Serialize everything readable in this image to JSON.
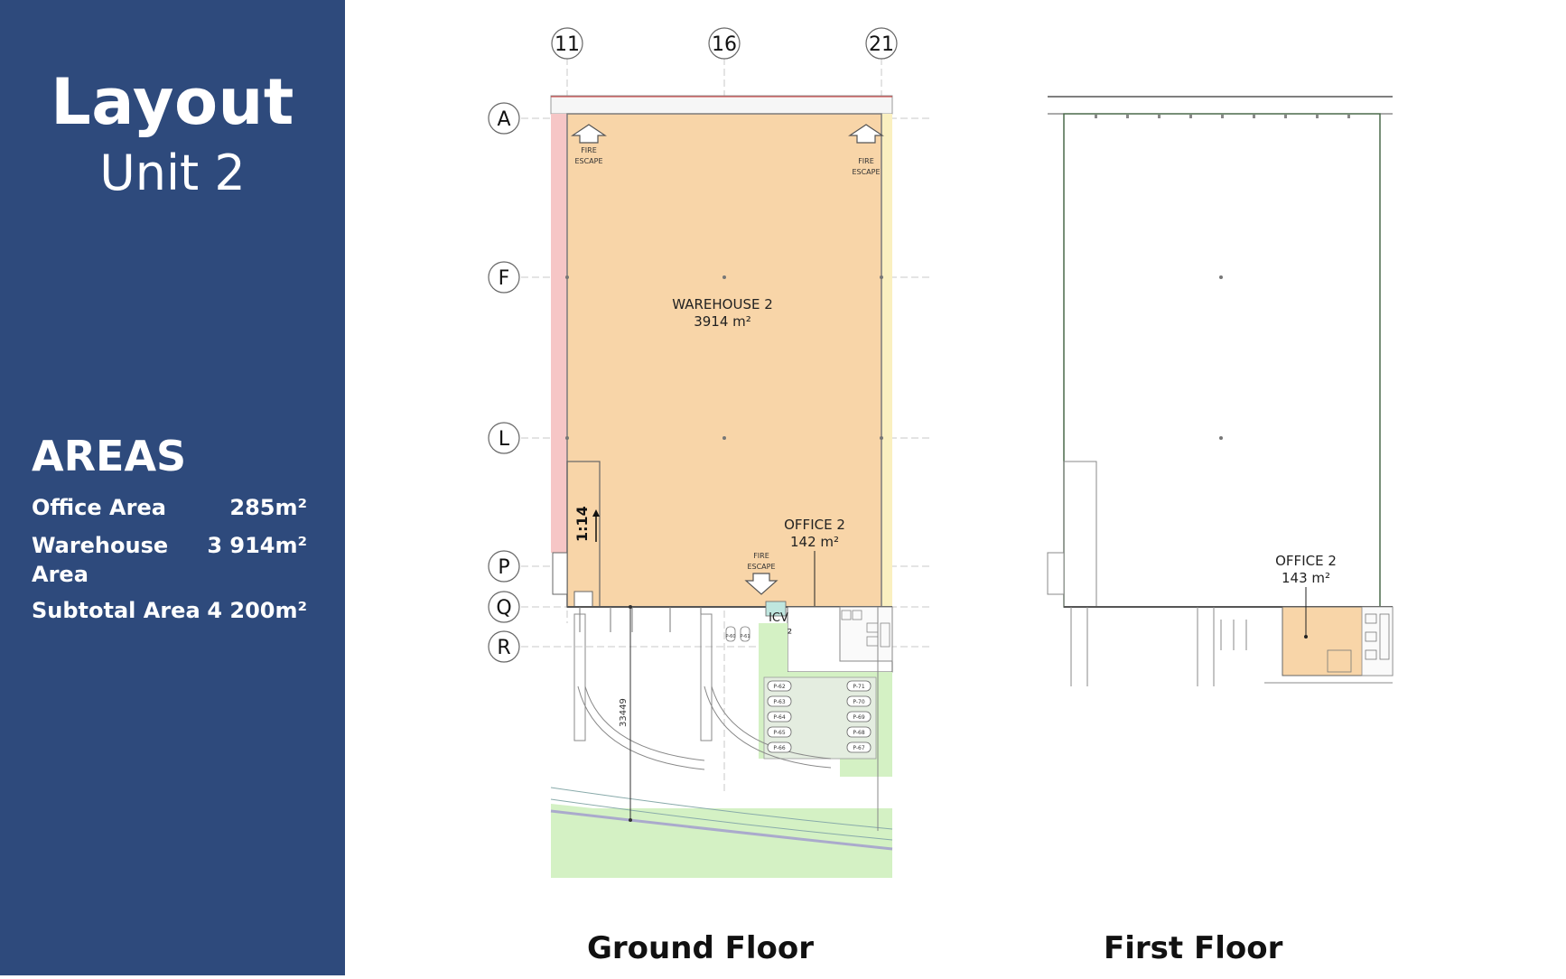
{
  "sidebar": {
    "title": "Layout",
    "subtitle": "Unit 2",
    "areas_heading": "AREAS",
    "areas": [
      {
        "label": "Office Area",
        "value": "285m²"
      },
      {
        "label": "Warehouse Area",
        "value": "3 914m²"
      },
      {
        "label": "Subtotal Area",
        "value": "4 200m²"
      }
    ]
  },
  "grid": {
    "columns": [
      "11",
      "16",
      "21"
    ],
    "rows": [
      "A",
      "F",
      "L",
      "P",
      "Q",
      "R"
    ]
  },
  "ground_floor": {
    "label": "Ground Floor",
    "warehouse_name": "WAREHOUSE 2",
    "warehouse_area": "3914 m²",
    "office_name": "OFFICE 2",
    "office_area": "142 m²",
    "icv_name": "ICV",
    "icv_area": "3 m²",
    "fire_escape_line1": "FIRE",
    "fire_escape_line2": "ESCAPE",
    "ramp": "1:14",
    "dimension": "33449",
    "bays": [
      "P-62",
      "P-63",
      "P-64",
      "P-65",
      "P-66",
      "P-71",
      "P-70",
      "P-69",
      "P-68",
      "P-67"
    ],
    "small_bays": [
      "P-60",
      "P-61"
    ]
  },
  "first_floor": {
    "label": "First Floor",
    "office_name": "OFFICE 2",
    "office_area": "143 m²"
  },
  "colors": {
    "sidebar": "#2e4a7c",
    "warehouse_fill": "#f8d5a8",
    "left_strip": "#f6c6c6",
    "right_strip": "#faf0c0",
    "landscape": "#d4f1c4"
  }
}
